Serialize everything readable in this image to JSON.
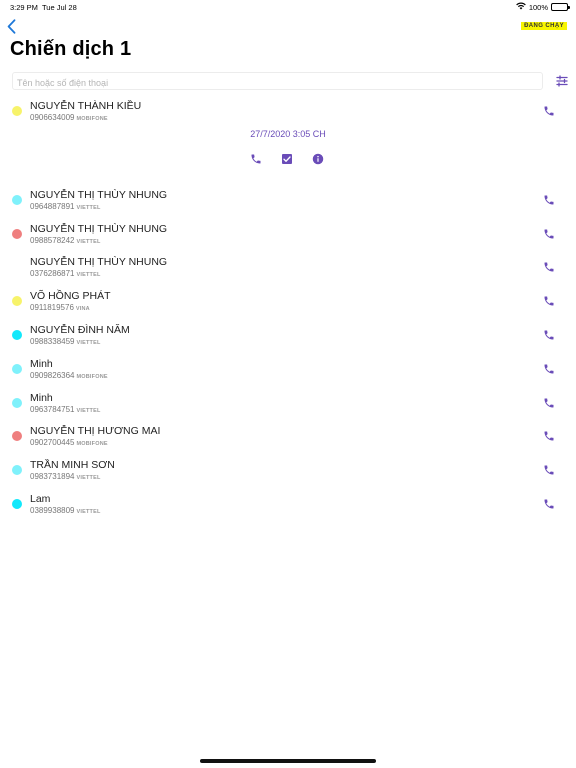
{
  "status_bar": {
    "time": "3:29 PM",
    "date": "Tue Jul 28",
    "battery": "100%",
    "icons": [
      "wifi-icon",
      "battery-icon"
    ]
  },
  "header": {
    "back_icon": "chevron-left-icon",
    "state_badge": "ĐANG CHẠY",
    "title": "Chiến dịch 1"
  },
  "search": {
    "placeholder": "Tên hoặc số điện thoại",
    "value": "",
    "filter_icon": "sliders-icon"
  },
  "colors": {
    "accent": "#6a4cb8",
    "badge_bg": "#f7f500",
    "dot_yellow": "#f7f36a",
    "dot_cyan_light": "#7ff1fb",
    "dot_cyan": "#12e8fb",
    "dot_red": "#ef7f7f"
  },
  "expanded": {
    "timestamp": "27/7/2020 3:05 CH",
    "action_icons": [
      "phone-icon",
      "checkbox-checked-icon",
      "info-icon"
    ]
  },
  "contacts": [
    {
      "name": "NGUYỄN THÀNH KIỀU",
      "phone": "0906634009",
      "carrier": "MOBIFONE",
      "dot": "#f7f36a",
      "expanded": true
    },
    {
      "name": "NGUYỄN THỊ THÙY NHUNG",
      "phone": "0964887891",
      "carrier": "VIETTEL",
      "dot": "#7ff1fb"
    },
    {
      "name": "NGUYỄN THỊ THÙY NHUNG",
      "phone": "0988578242",
      "carrier": "VIETTEL",
      "dot": "#ef7f7f"
    },
    {
      "name": "NGUYỄN THỊ THÙY NHUNG",
      "phone": "0376286871",
      "carrier": "VIETTEL",
      "dot": ""
    },
    {
      "name": "VÕ HỒNG PHÁT",
      "phone": "0911819576",
      "carrier": "VINA",
      "dot": "#f7f36a"
    },
    {
      "name": "NGUYỄN ĐÌNH NĂM",
      "phone": "0988338459",
      "carrier": "VIETTEL",
      "dot": "#12e8fb"
    },
    {
      "name": "Minh",
      "phone": "0909826364",
      "carrier": "MOBIFONE",
      "dot": "#7ff1fb"
    },
    {
      "name": "Minh",
      "phone": "0963784751",
      "carrier": "VIETTEL",
      "dot": "#7ff1fb"
    },
    {
      "name": "NGUYỄN THỊ HƯƠNG MAI",
      "phone": "0902700445",
      "carrier": "MOBIFONE",
      "dot": "#ef7f7f"
    },
    {
      "name": "TRẦN MINH SƠN",
      "phone": "0983731894",
      "carrier": "VIETTEL",
      "dot": "#7ff1fb"
    },
    {
      "name": "Lam",
      "phone": "0389938809",
      "carrier": "VIETTEL",
      "dot": "#12e8fb"
    }
  ]
}
